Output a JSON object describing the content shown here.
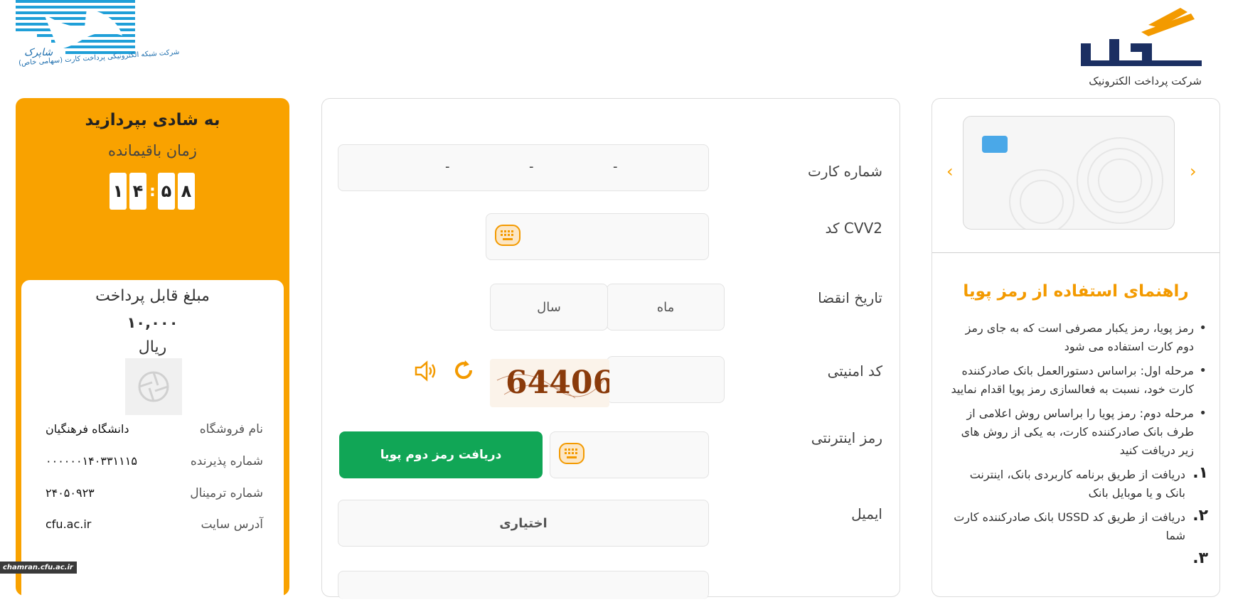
{
  "shaparak": {
    "logo_name": "شاپرک",
    "logo_caption": "شرکت شبکه الکترونیکی پرداخت کارت (سهامی خاص)"
  },
  "sadad": {
    "logo_text": "سداد",
    "subtitle": "شرکت پرداخت الکترونیک"
  },
  "timer_panel": {
    "title": "به شادی بپردازید",
    "remaining_label": "زمان باقیمانده",
    "minutes": [
      "۱",
      "۴"
    ],
    "seconds": [
      "۵",
      "۸"
    ],
    "colon": ":"
  },
  "payment": {
    "amount_label": "مبلغ قابل پرداخت",
    "amount": "۱۰,۰۰۰",
    "currency": "ریال",
    "info": [
      {
        "label": "نام فروشگاه",
        "value": "دانشگاه فرهنگیان"
      },
      {
        "label": "شماره پذیرنده",
        "value": "۰۰۰۰۰۰۱۴۰۳۳۱۱۱۵"
      },
      {
        "label": "شماره ترمینال",
        "value": "۲۴۰۵۰۹۲۳"
      },
      {
        "label": "آدرس سایت",
        "value": "cfu.ac.ir"
      }
    ]
  },
  "watermark": "chamran.cfu.ac.ir",
  "form": {
    "card_number_label": "شماره کارت",
    "card_dash": "-",
    "cvv2_label": "کد CVV2",
    "expiry_label": "تاریخ انقضا",
    "month_placeholder": "ماه",
    "year_placeholder": "سال",
    "security_label": "کد امنیتی",
    "captcha_text": "64406",
    "password_label": "رمز اینترنتی",
    "get_otp_button": "دریافت رمز دوم پویا",
    "email_label": "ایمیل",
    "email_placeholder": "اختیاری"
  },
  "guide": {
    "title": "راهنمای استفاده از رمز پویا",
    "bullets": [
      "رمز پویا، رمز یکبار مصرفی است که به جای رمز دوم کارت استفاده می شود",
      "مرحله اول: براساس دستورالعمل بانک صادرکننده کارت خود، نسبت به فعالسازی رمز پویا اقدام نمایید",
      "مرحله دوم: رمز پویا را براساس روش اعلامی از طرف بانک صادرکننده کارت، به یکی از روش های زیر دریافت کنید"
    ],
    "steps": [
      {
        "num": "۱.",
        "text": "دریافت از طریق برنامه کاربردی بانک، اینترنت بانک و یا موبایل بانک"
      },
      {
        "num": "۲.",
        "text": "دریافت از طریق کد USSD بانک صادرکننده کارت شما"
      },
      {
        "num": "۳.",
        "text": ""
      }
    ]
  },
  "colors": {
    "orange": "#f9a200",
    "green": "#11a656",
    "guide_title": "#f39a00",
    "shaparak_blue": "#1f9fd8"
  }
}
